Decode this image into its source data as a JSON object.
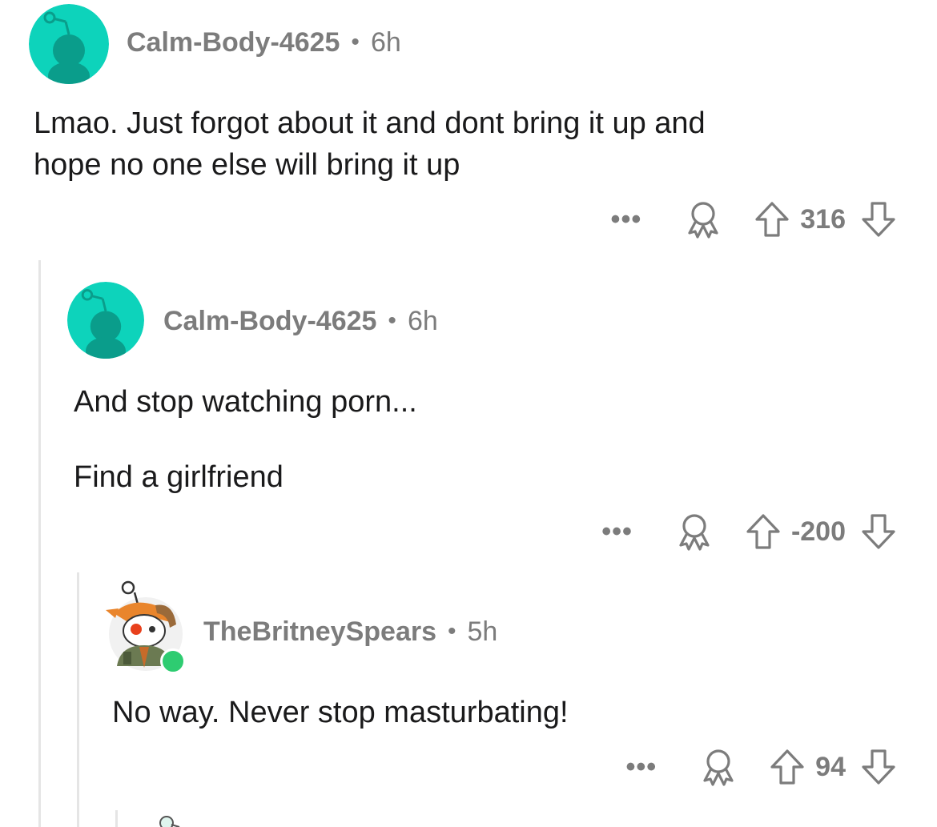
{
  "comments": [
    {
      "username": "Calm-Body-4625",
      "separator": "•",
      "age": "6h",
      "lines": [
        "Lmao. Just forgot about it and dont bring it up and",
        "hope no one else will bring it up"
      ],
      "more": "•••",
      "score": "316",
      "avatar_color": "#0dd3bb"
    },
    {
      "username": "Calm-Body-4625",
      "separator": "•",
      "age": "6h",
      "lines": [
        "And stop watching porn...",
        "Find a girlfriend"
      ],
      "more": "•••",
      "score": "-200",
      "avatar_color": "#0dd3bb"
    },
    {
      "username": "TheBritneySpears",
      "separator": "•",
      "age": "5h",
      "lines": [
        "No way. Never stop masturbating!"
      ],
      "more": "•••",
      "score": "94",
      "online_color": "#2ecc71"
    }
  ],
  "icons": {
    "award": "award-icon",
    "upvote": "upvote-arrow-icon",
    "downvote": "downvote-arrow-icon",
    "more": "more-options-icon"
  },
  "colors": {
    "meta_text": "#7c7c7c",
    "body_text": "#1a1a1b",
    "thread_line": "#e5e5e5"
  }
}
